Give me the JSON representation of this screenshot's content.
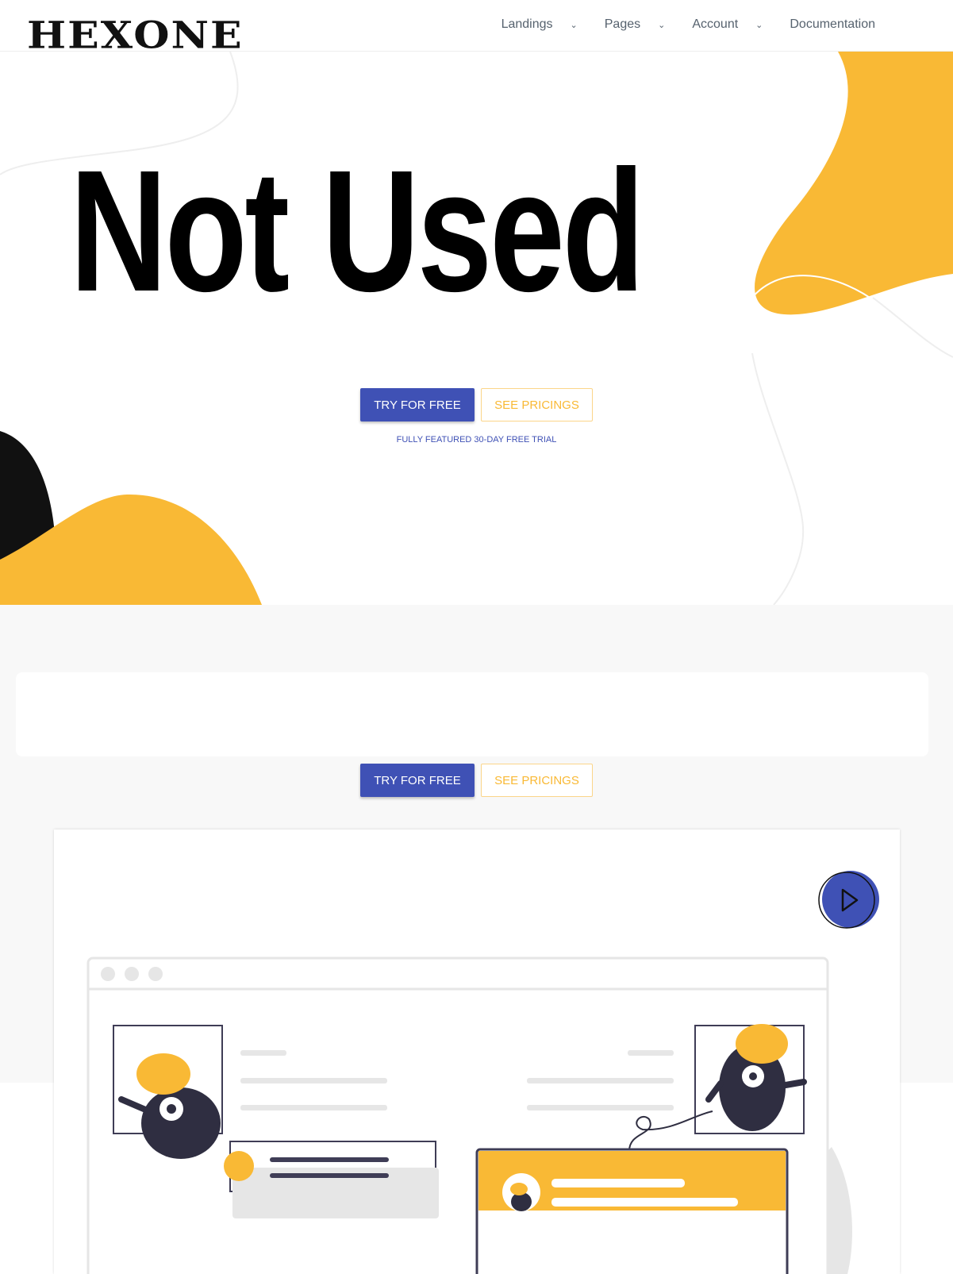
{
  "brand": {
    "logo": "HEXONE"
  },
  "nav": {
    "items": [
      {
        "label": "Landings",
        "dropdown": true
      },
      {
        "label": "Pages",
        "dropdown": true
      },
      {
        "label": "Account",
        "dropdown": true
      },
      {
        "label": "Documentation",
        "dropdown": false
      }
    ]
  },
  "hero": {
    "title": "Not Used",
    "primary_button": "TRY FOR FREE",
    "secondary_button": "SEE PRICINGS",
    "trial_note": "FULLY FEATURED 30-DAY FREE TRIAL"
  },
  "section2": {
    "primary_button": "TRY FOR FREE",
    "secondary_button": "SEE PRICINGS"
  },
  "colors": {
    "accent": "#3f51b5",
    "yellow": "#f9b935",
    "dark": "#2f2e41"
  }
}
